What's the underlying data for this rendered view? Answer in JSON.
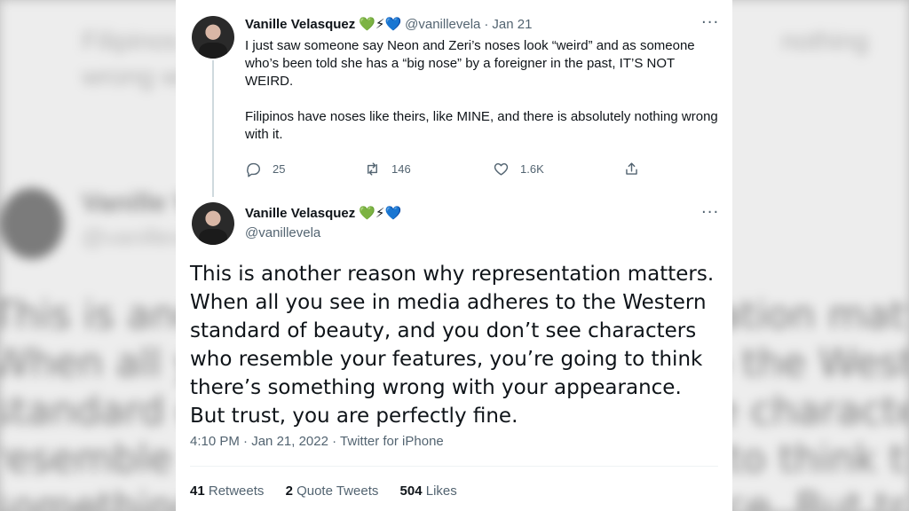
{
  "background": {
    "lines": [
      "This is another reason why representation matters.",
      "When all you see in media adheres to the Western",
      "standard of beauty, and you don't see characters who",
      "resemble your features, you're going to think there's",
      "something wrong with your appearance. But trust, you"
    ]
  },
  "tweet1": {
    "name": "Vanille Velasquez",
    "emojis": "💚⚡💙",
    "handle": "@vanillevela",
    "separator": "·",
    "date": "Jan 21",
    "text": [
      "I just saw someone say Neon and Zeri’s noses look “weird” and as someone who’s been told she has a “big nose” by a foreigner in the past, IT’S NOT WEIRD.",
      "Filipinos have noses like theirs, like MINE, and there is absolutely nothing wrong with it."
    ],
    "actions": {
      "replies": "25",
      "retweets": "146",
      "likes": "1.6K"
    },
    "more": "···"
  },
  "tweet2": {
    "name": "Vanille Velasquez",
    "emojis": "💚⚡💙",
    "handle": "@vanillevela",
    "more": "···",
    "text": "This is another reason why representation matters. When all you see in media adheres to the Western standard of beauty, and you don’t see characters who resemble your features, you’re going to think there’s something wrong with your appearance. But trust, you are perfectly fine.",
    "time": "4:10 PM",
    "date": "Jan 21, 2022",
    "source": "Twitter for iPhone",
    "stats": {
      "retweets_count": "41",
      "retweets_label": "Retweets",
      "quotes_count": "2",
      "quotes_label": "Quote Tweets",
      "likes_count": "504",
      "likes_label": "Likes"
    }
  },
  "colors": {
    "text": "#0f1419",
    "secondary": "#536471",
    "thread_line": "#cfd9de"
  }
}
